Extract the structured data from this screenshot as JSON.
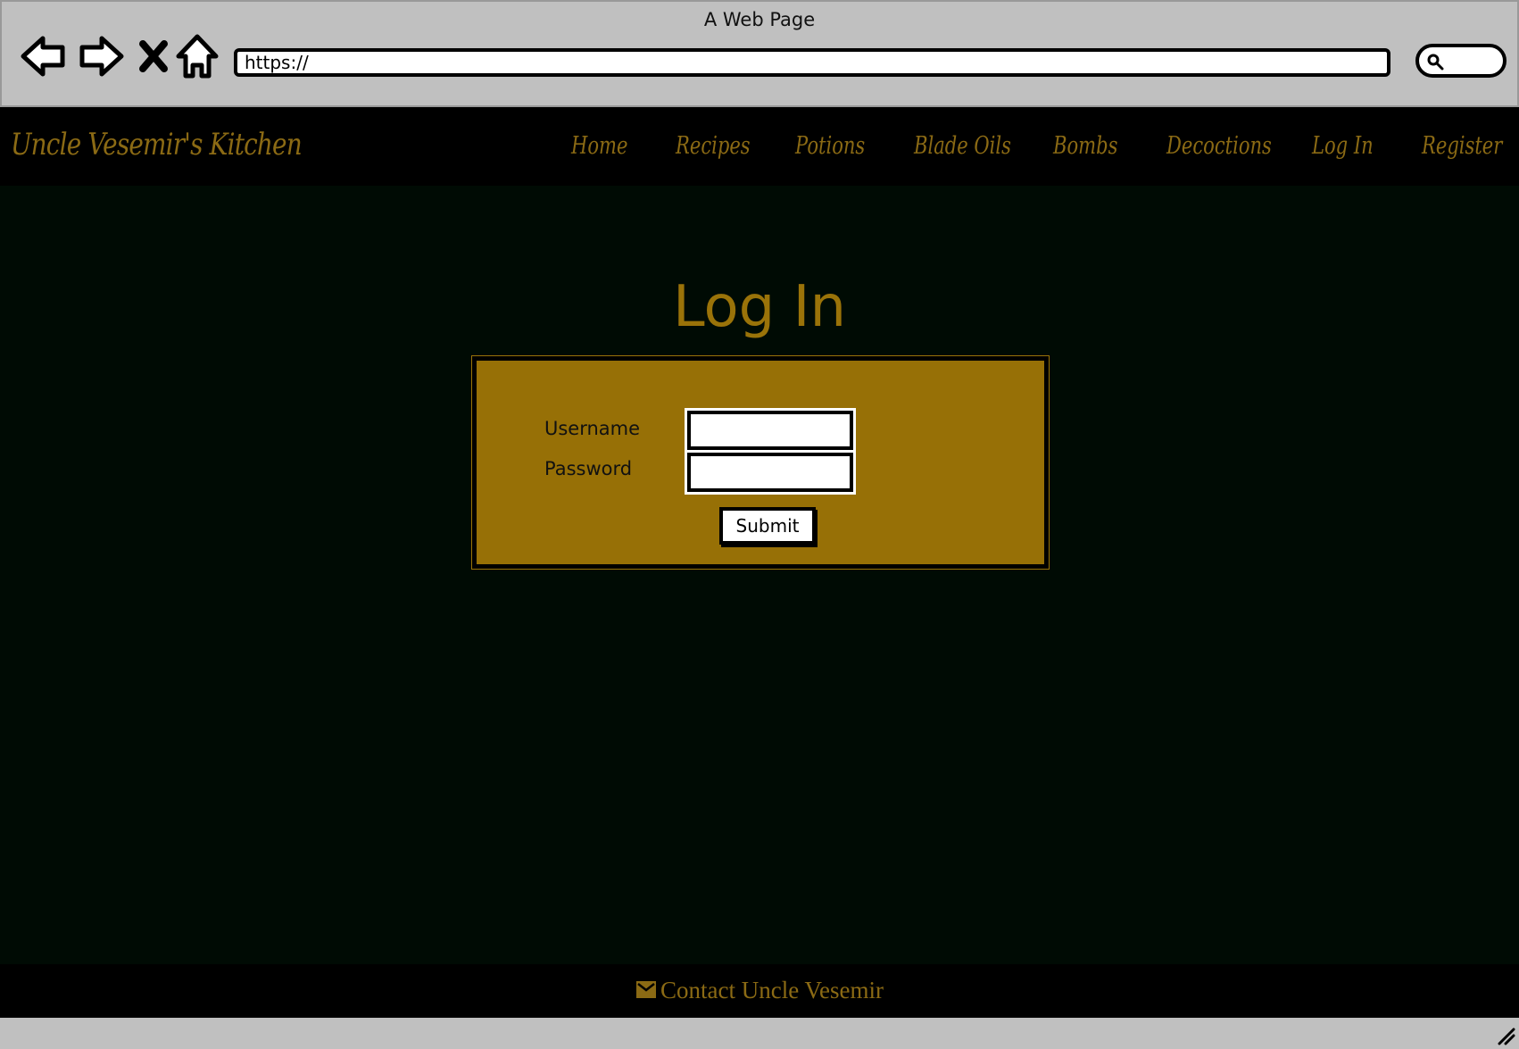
{
  "window": {
    "title": "A Web Page",
    "url": "https://"
  },
  "header": {
    "logo": "Uncle Vesemir's Kitchen",
    "nav": [
      {
        "label": "Home"
      },
      {
        "label": "Recipes"
      },
      {
        "label": "Potions"
      },
      {
        "label": "Blade Oils"
      },
      {
        "label": "Bombs"
      },
      {
        "label": "Decoctions"
      },
      {
        "label": "Log In"
      },
      {
        "label": "Register"
      }
    ]
  },
  "main": {
    "title": "Log In",
    "form": {
      "username_label": "Username",
      "username_value": "",
      "password_label": "Password",
      "password_value": "",
      "submit_label": "Submit"
    }
  },
  "footer": {
    "contact_label": "Contact Uncle Vesemir",
    "contact_icon": "envelope-icon"
  },
  "colors": {
    "accent": "#9a7309",
    "page_bg": "#000b04",
    "chrome": "#c0c0c0"
  }
}
